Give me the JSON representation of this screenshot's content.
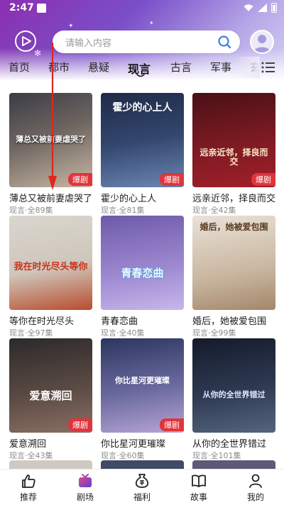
{
  "status_bar": {
    "time": "2:47"
  },
  "search": {
    "placeholder": "请输入内容"
  },
  "tabs": [
    {
      "label": "首页"
    },
    {
      "label": "都市"
    },
    {
      "label": "悬疑"
    },
    {
      "label": "现言",
      "active": true
    },
    {
      "label": "古言"
    },
    {
      "label": "军事"
    },
    {
      "label": "玄"
    }
  ],
  "cards": [
    {
      "title": "薄总又被前妻虐哭了",
      "meta": "现言·全89集",
      "badge": "爆剧",
      "poster_text": "薄总又被前妻虐哭了",
      "colors": [
        "#3b3c46",
        "#c9b8a4"
      ]
    },
    {
      "title": "霍少的心上人",
      "meta": "现言·全81集",
      "badge": "爆剧",
      "poster_text": "霍少的心上人",
      "colors": [
        "#1f2b47",
        "#6c86b3"
      ]
    },
    {
      "title": "远亲近邻，择良而交",
      "meta": "现言·全42集",
      "badge": "爆剧",
      "poster_text": "远亲近邻，择良而交",
      "colors": [
        "#4a1016",
        "#a11f2a"
      ]
    },
    {
      "title": "等你在时光尽头",
      "meta": "现言·全97集",
      "badge": "",
      "poster_text": "我在时光尽头等你",
      "colors": [
        "#d9d6cf",
        "#b84c2e"
      ]
    },
    {
      "title": "青春恋曲",
      "meta": "现言·全40集",
      "badge": "",
      "poster_text": "青春恋曲",
      "colors": [
        "#6d5aa8",
        "#c7b7ea"
      ]
    },
    {
      "title": "婚后，她被爱包围",
      "meta": "现言·全99集",
      "badge": "",
      "poster_text": "婚后，她被爱包围",
      "colors": [
        "#e9e2d8",
        "#a4876a"
      ]
    },
    {
      "title": "爱意溯回",
      "meta": "现言·全43集",
      "badge": "爆剧",
      "poster_text": "爱意溯回",
      "colors": [
        "#2c2a2b",
        "#8a6f63"
      ]
    },
    {
      "title": "你比星河更璀璨",
      "meta": "现言·全60集",
      "badge": "爆剧",
      "poster_text": "你比星河更璀璨",
      "colors": [
        "#2c3560",
        "#b7a4d6"
      ]
    },
    {
      "title": "从你的全世界错过",
      "meta": "现言·全101集",
      "badge": "",
      "poster_text": "从你的全世界错过",
      "colors": [
        "#141a2a",
        "#55657e"
      ]
    }
  ],
  "bottom_nav": [
    {
      "label": "推荐",
      "icon": "thumbs-up-icon"
    },
    {
      "label": "剧场",
      "icon": "tv-icon",
      "active": true
    },
    {
      "label": "福利",
      "icon": "money-bag-icon"
    },
    {
      "label": "故事",
      "icon": "book-icon"
    },
    {
      "label": "我的",
      "icon": "user-icon"
    }
  ]
}
